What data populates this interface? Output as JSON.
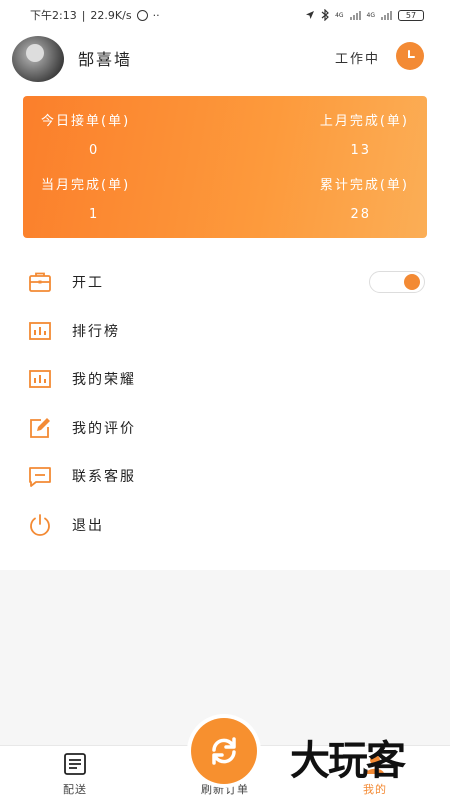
{
  "status_bar": {
    "time": "下午2:13",
    "net_speed": "22.9K/s",
    "dots": "··",
    "sig1_label": "4G",
    "sig2_label": "4G",
    "battery": "57"
  },
  "header": {
    "user_name": "郜喜墙",
    "work_status": "工作中"
  },
  "stats": {
    "today_orders_label": "今日接单(单)",
    "today_orders_value": "0",
    "last_month_label": "上月完成(单)",
    "last_month_value": "13",
    "this_month_label": "当月完成(单)",
    "this_month_value": "1",
    "total_label": "累计完成(单)",
    "total_value": "28"
  },
  "menu": {
    "items": [
      {
        "label": "开工"
      },
      {
        "label": "排行榜"
      },
      {
        "label": "我的荣耀"
      },
      {
        "label": "我的评价"
      },
      {
        "label": "联系客服"
      },
      {
        "label": "退出"
      }
    ],
    "start_work_toggle_on": true
  },
  "tab_bar": {
    "delivery_label": "配送",
    "refresh_label": "刷新订单",
    "mine_label": "我的"
  },
  "watermark": "大玩客",
  "colors": {
    "accent": "#f38a34",
    "card_gradient_start": "#fb7f2b",
    "card_gradient_end": "#fbae56"
  }
}
